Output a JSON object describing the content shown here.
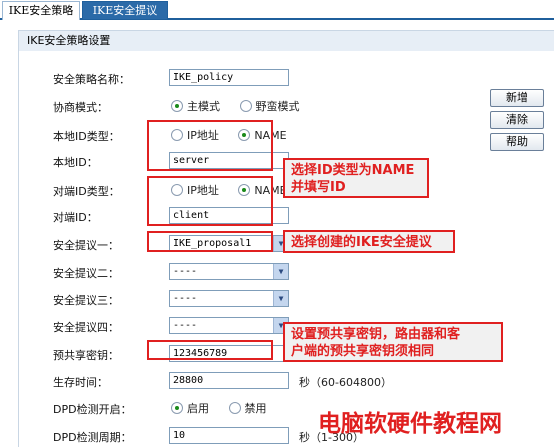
{
  "tabs": [
    {
      "label": "IKE安全策略",
      "active": true
    },
    {
      "label": "IKE安全提议",
      "active": false
    }
  ],
  "panel_title": "IKE安全策略设置",
  "form": {
    "policy_name": {
      "label": "安全策略名称：",
      "value": "IKE_policy"
    },
    "negotiation_mode": {
      "label": "协商模式：",
      "options": [
        "主模式",
        "野蛮模式"
      ],
      "selected": "主模式"
    },
    "local_id_type": {
      "label": "本地ID类型：",
      "options": [
        "IP地址",
        "NAME"
      ],
      "selected": "NAME"
    },
    "local_id": {
      "label": "本地ID：",
      "value": "server"
    },
    "peer_id_type": {
      "label": "对端ID类型：",
      "options": [
        "IP地址",
        "NAME"
      ],
      "selected": "NAME"
    },
    "peer_id": {
      "label": "对端ID：",
      "value": "client"
    },
    "proposal_1": {
      "label": "安全提议一：",
      "value": "IKE_proposal1"
    },
    "proposal_2": {
      "label": "安全提议二：",
      "value": "----"
    },
    "proposal_3": {
      "label": "安全提议三：",
      "value": "----"
    },
    "proposal_4": {
      "label": "安全提议四：",
      "value": "----"
    },
    "psk": {
      "label": "预共享密钥：",
      "value": "123456789"
    },
    "lifetime": {
      "label": "生存时间：",
      "value": "28800",
      "suffix": "秒（60-604800）"
    },
    "dpd_enable": {
      "label": "DPD检测开启：",
      "options": [
        "启用",
        "禁用"
      ],
      "selected": "启用"
    },
    "dpd_period": {
      "label": "DPD检测周期：",
      "value": "10",
      "suffix": "秒（1-300）"
    }
  },
  "buttons": {
    "add": "新增",
    "clear": "清除",
    "help": "帮助"
  },
  "annotations": {
    "id_type_note_line1": "选择ID类型为NAME",
    "id_type_note_line2": "并填写ID",
    "proposal_note": "选择创建的IKE安全提议",
    "psk_note_line1": "设置预共享密钥，路由器和客",
    "psk_note_line2": "户端的预共享密钥须相同"
  },
  "watermark": "电脑软硬件教程网",
  "colors": {
    "accent": "#2b6aa8",
    "annotation_red": "#e02020",
    "panel_header": "#e7eef6"
  }
}
